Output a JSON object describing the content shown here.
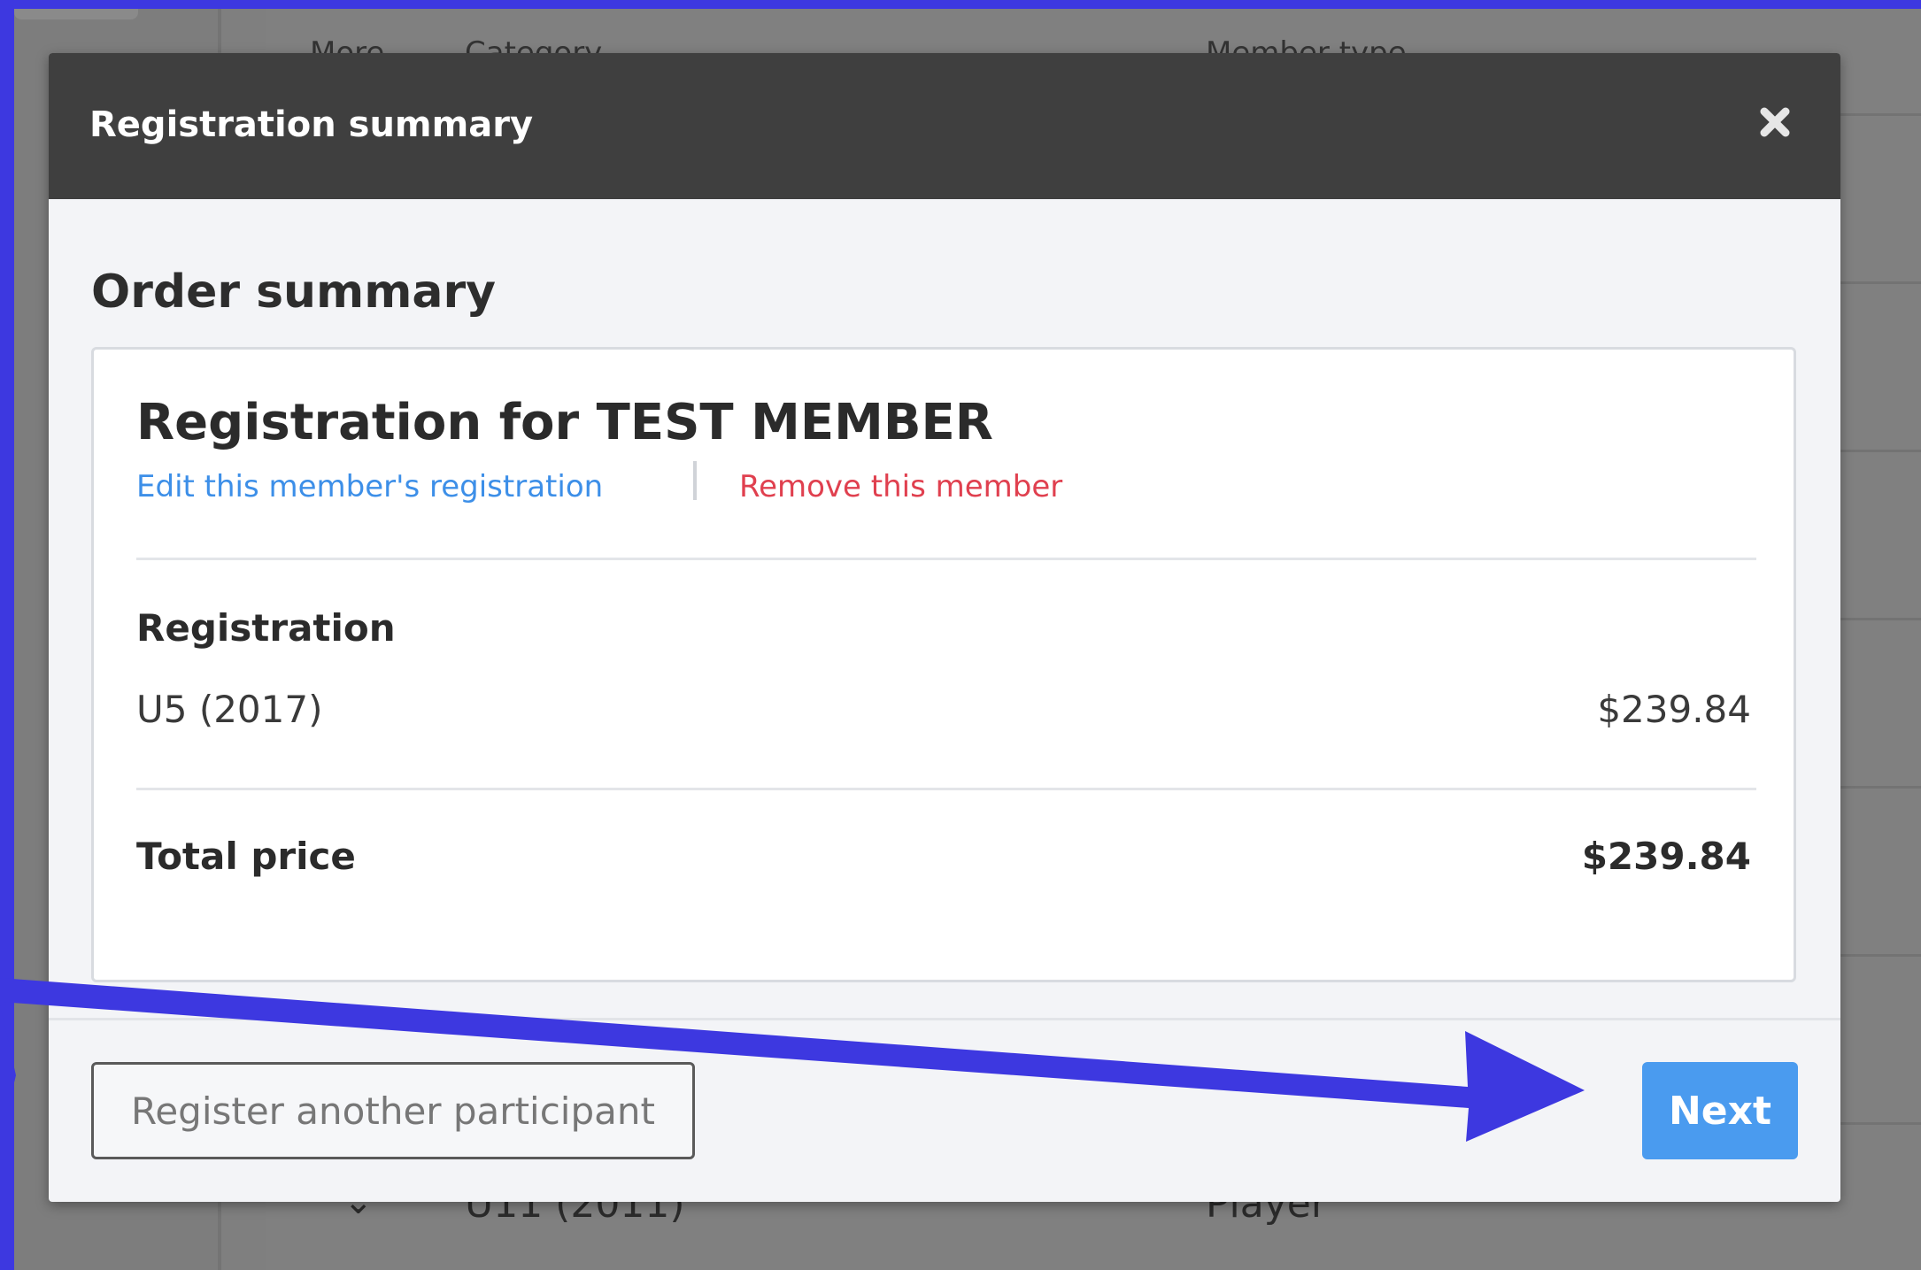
{
  "background": {
    "headers": [
      "More",
      "Category",
      "Member type"
    ],
    "bottom_row": {
      "category": "U11 (2011)",
      "member_type": "Player"
    }
  },
  "modal": {
    "title": "Registration summary",
    "close_icon": "close-icon",
    "order_summary_title": "Order summary",
    "member_heading": "Registration for TEST MEMBER",
    "edit_link": "Edit this member's registration",
    "remove_link": "Remove this member",
    "registration_label": "Registration",
    "line_items": [
      {
        "name": "U5 (2017)",
        "price": "$239.84"
      }
    ],
    "total_label": "Total price",
    "total_value": "$239.84",
    "register_another_label": "Register another participant",
    "next_label": "Next"
  },
  "colors": {
    "annotation_arrow": "#3d38e0",
    "link_blue": "#3d8fe8",
    "link_red": "#e0404f",
    "next_button": "#4a9bef",
    "modal_header": "#3f3f3f"
  }
}
